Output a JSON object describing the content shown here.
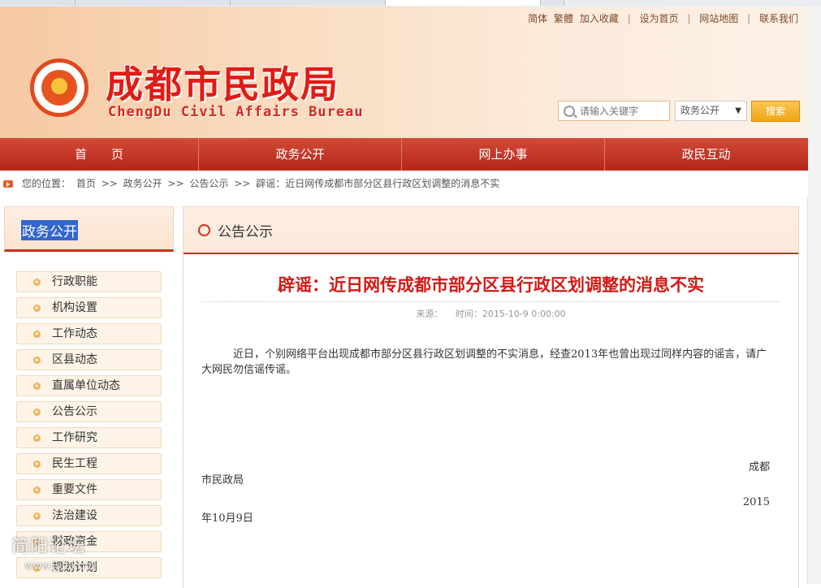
{
  "toplinks": {
    "simplified": "简体",
    "traditional": "繁體",
    "favorite": "加入收藏",
    "sep1": "|",
    "homepage": "设为首页",
    "sep2": "|",
    "sitemap": "网站地图",
    "sep3": "|",
    "contact": "联系我们"
  },
  "brand": {
    "title": "成都市民政局",
    "subtitle": "ChengDu Civil Affairs Bureau",
    "accent_color": "#e11b16"
  },
  "search": {
    "placeholder": "请输入关键字",
    "scope": "政务公开",
    "scope_arrow": "▼",
    "button": "搜索"
  },
  "nav": {
    "items": [
      {
        "label": "首　　页"
      },
      {
        "label": "政务公开"
      },
      {
        "label": "网上办事"
      },
      {
        "label": "政民互动"
      }
    ]
  },
  "breadcrumb": {
    "prefix": "您的位置：",
    "home": "首页",
    "sep": ">>",
    "level1": "政务公开",
    "level2": "公告公示",
    "current": "辟谣：近日网传成都市部分区县行政区划调整的消息不实"
  },
  "sidebar": {
    "title": "政务公开",
    "items": [
      {
        "label": "行政职能"
      },
      {
        "label": "机构设置"
      },
      {
        "label": "工作动态"
      },
      {
        "label": "区县动态"
      },
      {
        "label": "直属单位动态"
      },
      {
        "label": "公告公示"
      },
      {
        "label": "工作研究"
      },
      {
        "label": "民生工程"
      },
      {
        "label": "重要文件"
      },
      {
        "label": "法治建设"
      },
      {
        "label": "财政资金"
      },
      {
        "label": "规划计划"
      }
    ]
  },
  "main": {
    "section_title": "公告公示",
    "article": {
      "title": "辟谣：近日网传成都市部分区县行政区划调整的消息不实",
      "source_label": "来源：",
      "time_label": "时间：2015-10-9 0:00:00",
      "body": "　　　近日，个别网络平台出现成都市部分区县行政区划调整的不实消息，经查2013年也曾出现过同样内容的谣言，请广大网民勿信谣传谣。",
      "sig_line1": "成都",
      "sig_line2": "市民政局",
      "date_line1": "2015",
      "date_line2": "年10月9日"
    }
  },
  "watermark": {
    "text": "简阳论坛",
    "url": "www.jylt.com"
  }
}
